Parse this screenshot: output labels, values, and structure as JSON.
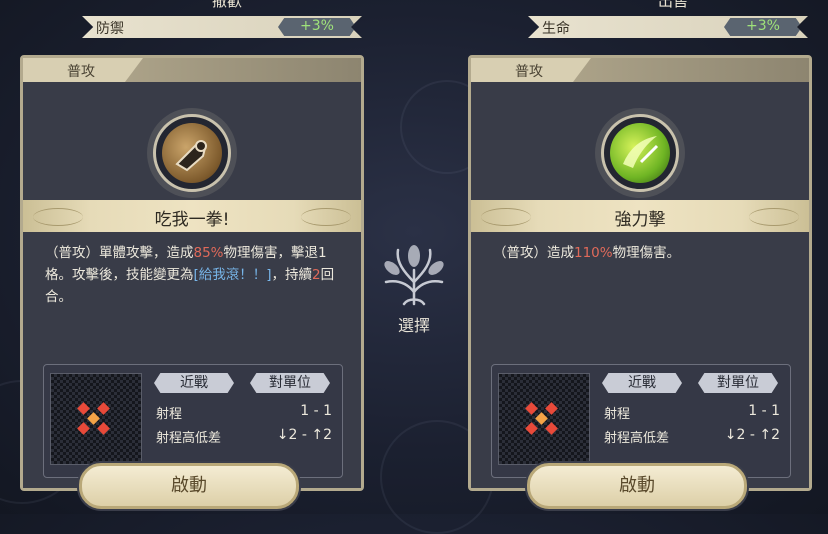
{
  "left": {
    "top_caption": "撤歡",
    "stat_name": "防禦",
    "stat_value": "+3%",
    "type": "普攻",
    "skill_name": "吃我一拳!",
    "desc_prefix": "（普攻）單體攻擊，造成",
    "desc_pct": "85%",
    "desc_mid": "物理傷害，擊退1格。攻擊後，技能變更為",
    "desc_link": "[給我滾！！]",
    "desc_mid2": "，持續",
    "desc_num": "2",
    "desc_suffix": "回合。",
    "tag1": "近戰",
    "tag2": "對單位",
    "range_label": "射程",
    "range_value": "1 - 1",
    "height_label": "射程高低差",
    "height_value": "↓2 - ↑2",
    "button": "啟動"
  },
  "right": {
    "top_caption": "出售",
    "stat_name": "生命",
    "stat_value": "+3%",
    "type": "普攻",
    "skill_name": "強力擊",
    "desc_prefix": "（普攻）造成",
    "desc_pct": "110%",
    "desc_suffix": "物理傷害。",
    "tag1": "近戰",
    "tag2": "對單位",
    "range_label": "射程",
    "range_value": "1 - 1",
    "height_label": "射程高低差",
    "height_value": "↓2 - ↑2",
    "button": "啟動"
  },
  "center": {
    "label": "選擇"
  },
  "icons": {
    "left_skill": "fist-icon",
    "right_skill": "sword-slash-icon",
    "center": "tree-emblem-icon",
    "range_pattern": "diamond-cross-pattern"
  },
  "colors": {
    "damage": "#e06a5a",
    "skill_link": "#78b6ea",
    "stat_bonus": "#9fe27a"
  }
}
